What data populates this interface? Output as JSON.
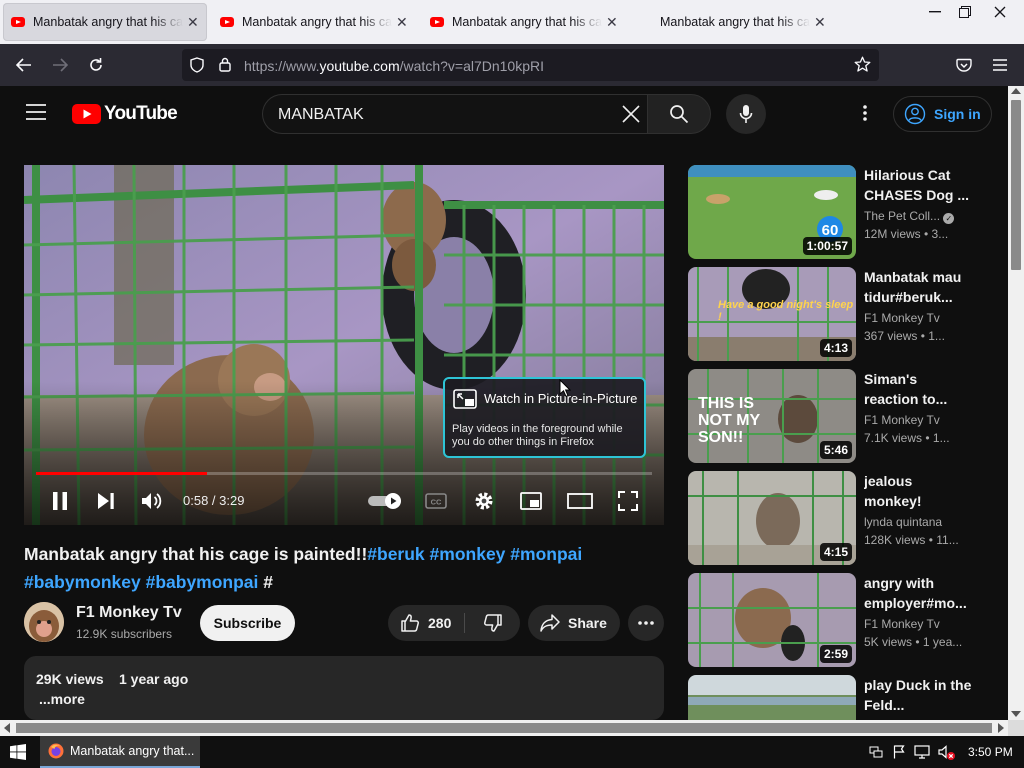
{
  "browser": {
    "tabs": [
      {
        "title": "Manbatak angry that his cage is painted",
        "active": true
      },
      {
        "title": "Manbatak angry that his cage is painted",
        "active": false
      },
      {
        "title": "Manbatak angry that his cage is painted",
        "active": false
      },
      {
        "title": "Manbatak angry that his cage is painted",
        "active": false
      }
    ],
    "url_prefix": "https://www.",
    "url_domain": "youtube.com",
    "url_path": "/watch?v=al7Dn10kpRI"
  },
  "youtube": {
    "logo_text": "YouTube",
    "search_value": "MANBATAK",
    "signin_label": "Sign in"
  },
  "player": {
    "time": "0:58 / 3:29",
    "progress": 0.277,
    "pip_title": "Watch in Picture-in-Picture",
    "pip_body": "Play videos in the foreground while you do other things in Firefox",
    "scene_text": "Have a good night's sleep !"
  },
  "video": {
    "title_plain": "Manbatak angry that his cage is painted!!",
    "hashtags": [
      "#beruk",
      "#monkey",
      "#monpai",
      "#babymonkey",
      "#babymonpai",
      "#"
    ],
    "channel_name": "F1 Monkey Tv",
    "subscribers": "12.9K subscribers",
    "subscribe_label": "Subscribe",
    "likes": "280",
    "share_label": "Share",
    "views": "29K views",
    "age": "1 year ago",
    "more_label": "...more"
  },
  "recommendations": [
    {
      "title": "Hilarious Cat CHASES Dog ...",
      "channel": "The Pet Coll...",
      "verified": true,
      "views": "12M views  •  3...",
      "duration": "1:00:57",
      "badge": "60"
    },
    {
      "title": "Manbatak mau tidur#beruk...",
      "channel": "F1 Monkey Tv",
      "verified": false,
      "views": "367 views  •  1...",
      "duration": "4:13",
      "caption": "Have a good night's sleep !"
    },
    {
      "title": "Siman's reaction to...",
      "channel": "F1 Monkey Tv",
      "verified": false,
      "views": "7.1K views  •  1...",
      "duration": "5:46",
      "caption": "THIS IS NOT MY SON!!"
    },
    {
      "title": "jealous monkey!",
      "channel": "lynda quintana",
      "verified": false,
      "views": "128K views  •  11...",
      "duration": "4:15"
    },
    {
      "title": "angry with employer#mo...",
      "channel": "F1 Monkey Tv",
      "verified": false,
      "views": "5K views  •  1 yea...",
      "duration": "2:59"
    },
    {
      "title": "play Duck in the Feld...",
      "channel": "",
      "verified": false,
      "views": "",
      "duration": ""
    }
  ],
  "taskbar": {
    "app_label": "Manbatak angry that...",
    "clock": "3:50 PM"
  },
  "colors": {
    "yt_red": "#ff0000",
    "link_blue": "#3ea6ff",
    "pip_border": "#2ec4d6",
    "progress_red": "#ff0000"
  }
}
